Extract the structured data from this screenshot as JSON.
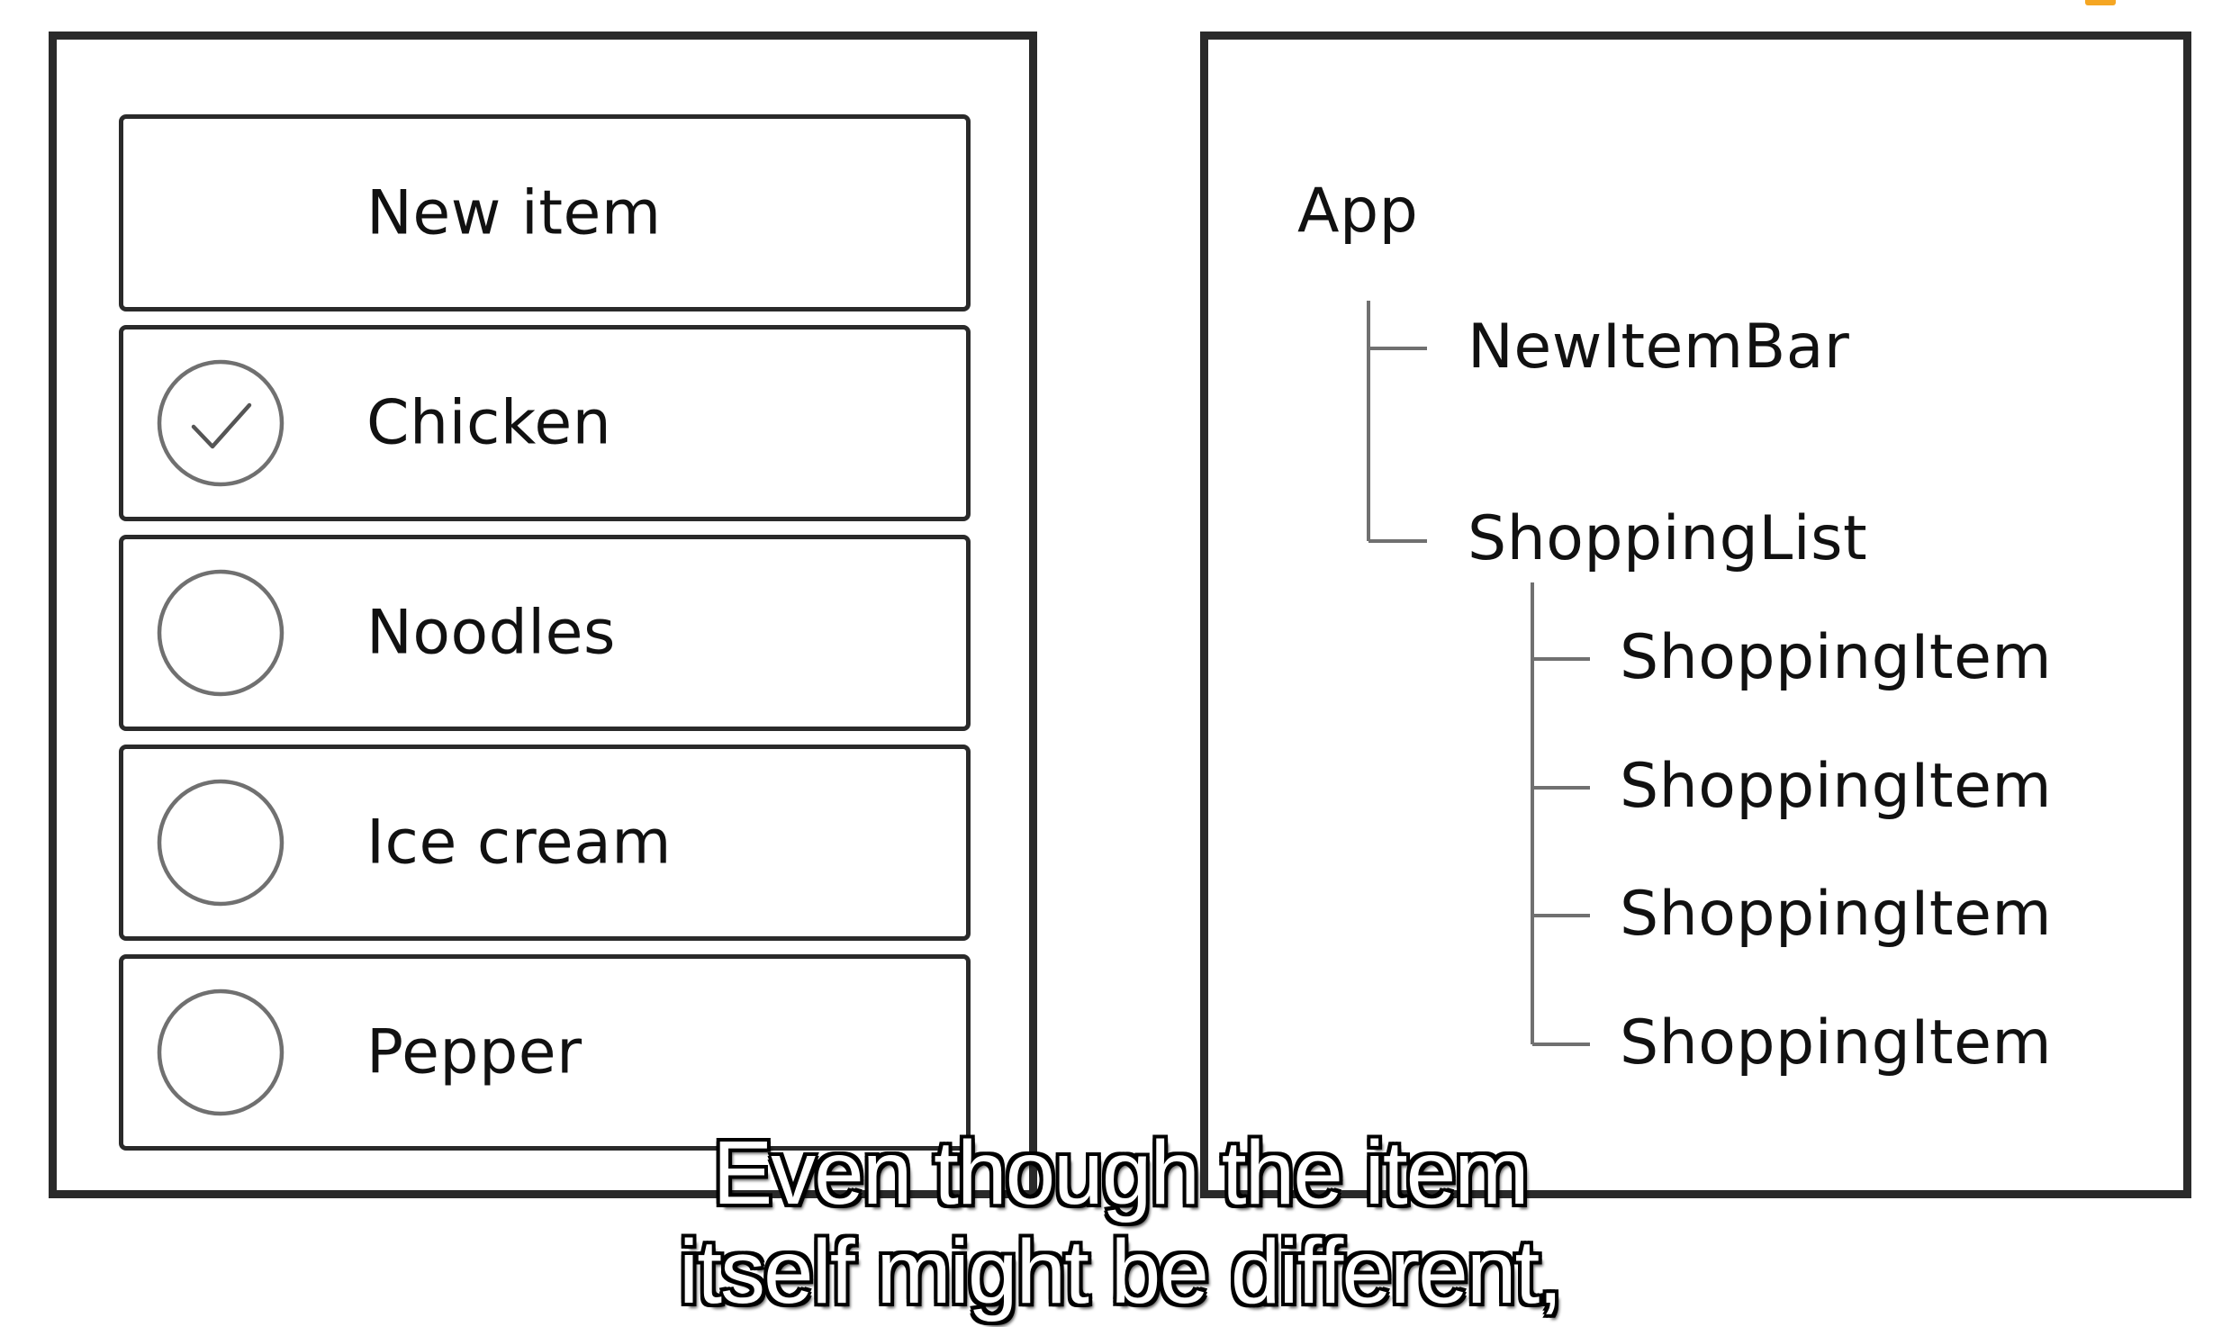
{
  "shopping_app": {
    "new_item_placeholder": "New item",
    "items": [
      {
        "label": "Chicken",
        "checked": true
      },
      {
        "label": "Noodles",
        "checked": false
      },
      {
        "label": "Ice cream",
        "checked": false
      },
      {
        "label": "Pepper",
        "checked": false
      }
    ]
  },
  "component_tree": {
    "root": "App",
    "new_item_bar": "NewItemBar",
    "shopping_list": "ShoppingList",
    "shopping_items": [
      "ShoppingItem",
      "ShoppingItem",
      "ShoppingItem",
      "ShoppingItem"
    ]
  },
  "caption": {
    "line1": "Even though the item",
    "line2": "itself might be different,"
  },
  "colors": {
    "border": "#2a2a2a",
    "circle": "#707070",
    "tree_line": "#707070",
    "caption_text": "#ffffff",
    "caption_outline": "#000000",
    "corner_accent": "#f5a623"
  },
  "icons": {
    "checked": "check-circle-icon",
    "unchecked": "empty-circle-icon"
  }
}
